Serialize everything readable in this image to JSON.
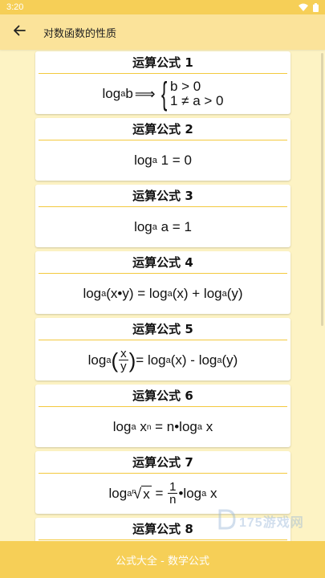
{
  "status_bar": {
    "time": "3:20"
  },
  "app_bar": {
    "title": "对数函数的性质"
  },
  "cards": [
    {
      "title": "运算公式 1"
    },
    {
      "title": "运算公式 2"
    },
    {
      "title": "运算公式 3"
    },
    {
      "title": "运算公式 4"
    },
    {
      "title": "运算公式 5"
    },
    {
      "title": "运算公式 6"
    },
    {
      "title": "运算公式 7"
    },
    {
      "title": "运算公式 8"
    }
  ],
  "formulas": {
    "f1": {
      "log": "log",
      "base": "a",
      "arg": "b",
      "arrow": "⟹",
      "case1": "b > 0",
      "case2": "1 ≠ a > 0",
      "brace": "{"
    },
    "f2": {
      "log": "log",
      "base": "a",
      "rest": " 1 = 0"
    },
    "f3": {
      "log": "log",
      "base": "a",
      "rest": " a = 1"
    },
    "f4": {
      "log1": "log",
      "base1": "a",
      "arg1": "(x•y) = ",
      "log2": "log",
      "base2": "a",
      "arg2": "(x) + ",
      "log3": "log",
      "base3": "a",
      "arg3": "(y)"
    },
    "f5": {
      "log1": "log",
      "base1": "a",
      "lparen": "(",
      "num": "x",
      "den": "y",
      "rparen": ")",
      "eq": "= ",
      "log2": "log",
      "base2": "a",
      "arg2": "(x) - ",
      "log3": "log",
      "base3": "a",
      "arg3": "(y)"
    },
    "f6": {
      "log1": "log",
      "base1": "a",
      "x": " x",
      "exp": "n",
      "mid": " = n•",
      "log2": "log",
      "base2": "a",
      "end": " x"
    },
    "f7": {
      "log1": "log",
      "base1": "a",
      "root_index": "n",
      "root_sign": "√",
      "radicand": "x",
      "eq": " = ",
      "num": "1",
      "den": "n",
      "dot": "•",
      "log2": "log",
      "base2": "a",
      "end": " x"
    }
  },
  "watermark": {
    "text": "175游戏网"
  },
  "bottom_bar": {
    "label": "公式大全 - 数学公式"
  },
  "colors": {
    "status_bar": "#f6cf57",
    "app_bar": "#fbe39a",
    "background": "#fdf3c4",
    "divider": "#f3c93e",
    "bottom_bar": "#f6cf57"
  },
  "icons": {
    "back": "arrow-left-icon",
    "wifi": "wifi-icon",
    "battery": "battery-icon"
  }
}
